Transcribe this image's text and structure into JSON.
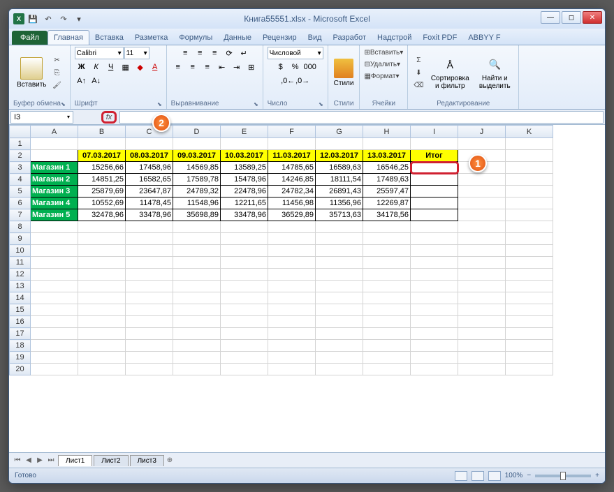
{
  "title": "Книга55551.xlsx - Microsoft Excel",
  "tabs": {
    "file": "Файл",
    "home": "Главная",
    "insert": "Вставка",
    "layout": "Разметка",
    "formulas": "Формулы",
    "data": "Данные",
    "review": "Рецензир",
    "view": "Вид",
    "dev": "Разработ",
    "addin": "Надстрой",
    "foxit": "Foxit PDF",
    "abbyy": "ABBYY F"
  },
  "groups": {
    "clipboard": "Буфер обмена",
    "font": "Шрифт",
    "align": "Выравнивание",
    "number": "Число",
    "styles": "Стили",
    "cells": "Ячейки",
    "editing": "Редактирование"
  },
  "ribbon": {
    "paste": "Вставить",
    "font_name": "Calibri",
    "font_size": "11",
    "num_format": "Числовой",
    "insert": "Вставить",
    "delete": "Удалить",
    "format": "Формат",
    "sort": "Сортировка и фильтр",
    "find": "Найти и выделить",
    "styles": "Стили"
  },
  "name_box": "I3",
  "columns": [
    "A",
    "B",
    "C",
    "D",
    "E",
    "F",
    "G",
    "H",
    "I",
    "J",
    "K"
  ],
  "dates": [
    "07.03.2017",
    "08.03.2017",
    "09.03.2017",
    "10.03.2017",
    "11.03.2017",
    "12.03.2017",
    "13.03.2017"
  ],
  "total_label": "Итог",
  "shops": [
    "Магазин 1",
    "Магазин 2",
    "Магазин 3",
    "Магазин 4",
    "Магазин 5"
  ],
  "values": [
    [
      "15256,66",
      "17458,96",
      "14569,85",
      "13589,25",
      "14785,65",
      "16589,63",
      "16546,25"
    ],
    [
      "14851,25",
      "16582,65",
      "17589,78",
      "15478,96",
      "14246,85",
      "18111,54",
      "17489,63"
    ],
    [
      "25879,69",
      "23647,87",
      "24789,32",
      "22478,96",
      "24782,34",
      "26891,43",
      "25597,47"
    ],
    [
      "10552,69",
      "11478,45",
      "11548,96",
      "12211,65",
      "11456,98",
      "11356,96",
      "12269,87"
    ],
    [
      "32478,96",
      "33478,96",
      "35698,89",
      "33478,96",
      "36529,89",
      "35713,63",
      "34178,56"
    ]
  ],
  "callouts": {
    "c1": "1",
    "c2": "2"
  },
  "sheets": [
    "Лист1",
    "Лист2",
    "Лист3"
  ],
  "status": "Готово",
  "zoom": "100%"
}
